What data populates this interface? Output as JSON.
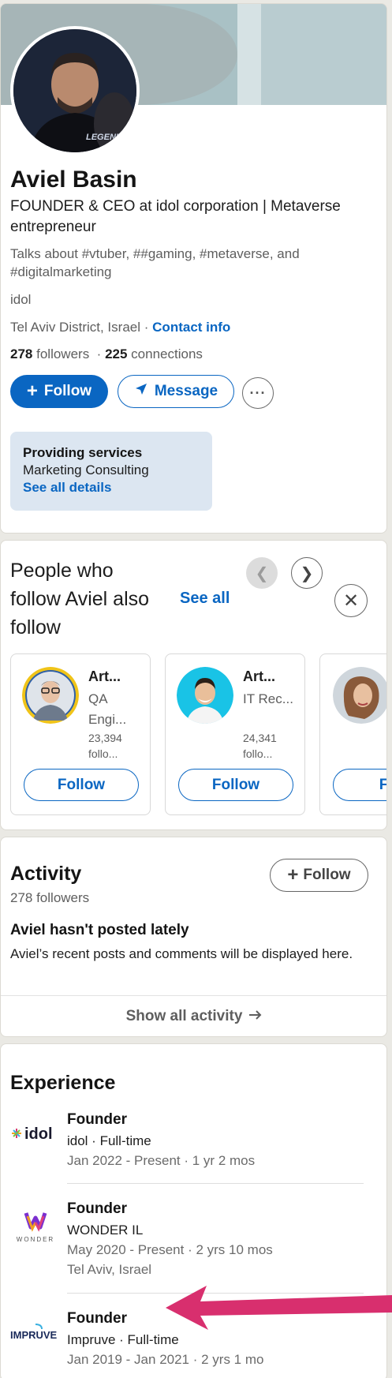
{
  "profile": {
    "name": "Aviel Basin",
    "headline": "FOUNDER & CEO at idol corporation | Metaverse entrepreneur",
    "talks_about": "Talks about #vtuber, ##gaming, #metaverse, and #digitalmarketing",
    "company": "idol",
    "location": "Tel Aviv District, Israel",
    "separator": "·",
    "contact_link": "Contact info",
    "followers_count": "278",
    "followers_label": "followers",
    "connections_count": "225",
    "connections_label": "connections",
    "follow_label": "Follow",
    "message_label": "Message",
    "more_label": "···",
    "avatar_caption": "LEGENDS",
    "services": {
      "title": "Providing services",
      "body": "Marketing Consulting",
      "link": "See all details"
    }
  },
  "people_also_follow": {
    "title": "People who follow Aviel also follow",
    "see_all": "See all",
    "people": [
      {
        "name": "Art...",
        "title": "QA Engi...",
        "followers": "23,394 follo...",
        "follow_label": "Follow"
      },
      {
        "name": "Art...",
        "title": "IT Rec...",
        "followers": "24,341 follo...",
        "follow_label": "Follow"
      },
      {
        "name": "",
        "title": "",
        "followers": "",
        "follow_label": "Fol"
      }
    ]
  },
  "activity": {
    "title": "Activity",
    "followers": "278 followers",
    "follow_label": "Follow",
    "empty_title": "Aviel hasn't posted lately",
    "empty_body": "Aviel’s recent posts and comments will be displayed here.",
    "show_all": "Show all activity"
  },
  "experience": {
    "title": "Experience",
    "items": [
      {
        "logo_text": "idol",
        "role": "Founder",
        "company": "idol · Full-time",
        "dates": "Jan 2022 - Present · 1 yr 2 mos",
        "location": ""
      },
      {
        "logo_text": "WONDER",
        "role": "Founder",
        "company": "WONDER IL",
        "dates": "May 2020 - Present · 2 yrs 10 mos",
        "location": "Tel Aviv, Israel"
      },
      {
        "logo_text": "IMPRUVE",
        "role": "Founder",
        "company": "Impruve · Full-time",
        "dates": "Jan 2019 - Jan 2021 · 2 yrs 1 mo",
        "location": ""
      }
    ]
  },
  "colors": {
    "brand_blue": "#0a66c2",
    "annotation_arrow": "#d82f6e",
    "services_bg": "#dce6f1"
  },
  "icons": [
    "plus-icon",
    "send-icon",
    "more-icon",
    "chevron-left-icon",
    "chevron-right-icon",
    "close-icon",
    "arrow-right-icon"
  ]
}
